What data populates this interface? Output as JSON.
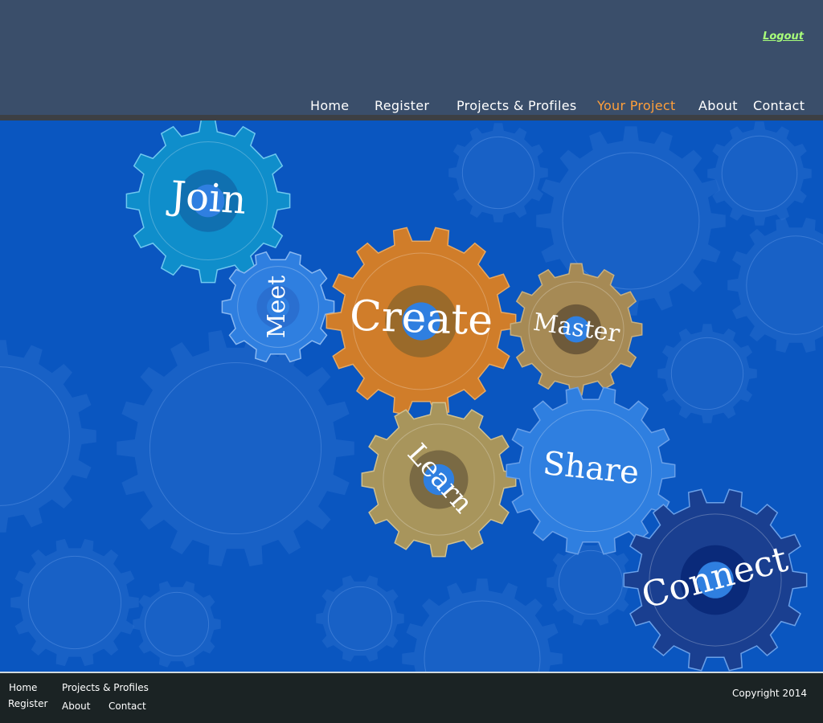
{
  "header": {
    "logout_label": "Logout",
    "nav": [
      {
        "label": "Home",
        "active": false
      },
      {
        "label": "Register",
        "active": false
      },
      {
        "label": "Projects & Profiles",
        "active": false
      },
      {
        "label": "Your Project",
        "active": true
      },
      {
        "label": "About",
        "active": false
      },
      {
        "label": "Contact",
        "active": false
      }
    ]
  },
  "gears": {
    "join": "Join",
    "meet": "Meet",
    "create": "Create",
    "master": "Master",
    "learn": "Learn",
    "share": "Share",
    "connect": "Connect"
  },
  "colors": {
    "header_bg": "#3a4e6a",
    "stage_bg": "#0a56c0",
    "join": "#0f8ecb",
    "meet": "#2f7fe0",
    "create": "#d07d2a",
    "master": "#a68a55",
    "learn": "#a8955c",
    "share": "#2f7fe0",
    "connect": "#1a3f90",
    "active_nav": "#ff9f3a",
    "logout": "#a8ff7a"
  },
  "footer": {
    "links": {
      "home": "Home",
      "projects": "Projects & Profiles",
      "register": "Register",
      "about": "About",
      "contact": "Contact"
    },
    "copyright": "Copyright 2014"
  }
}
